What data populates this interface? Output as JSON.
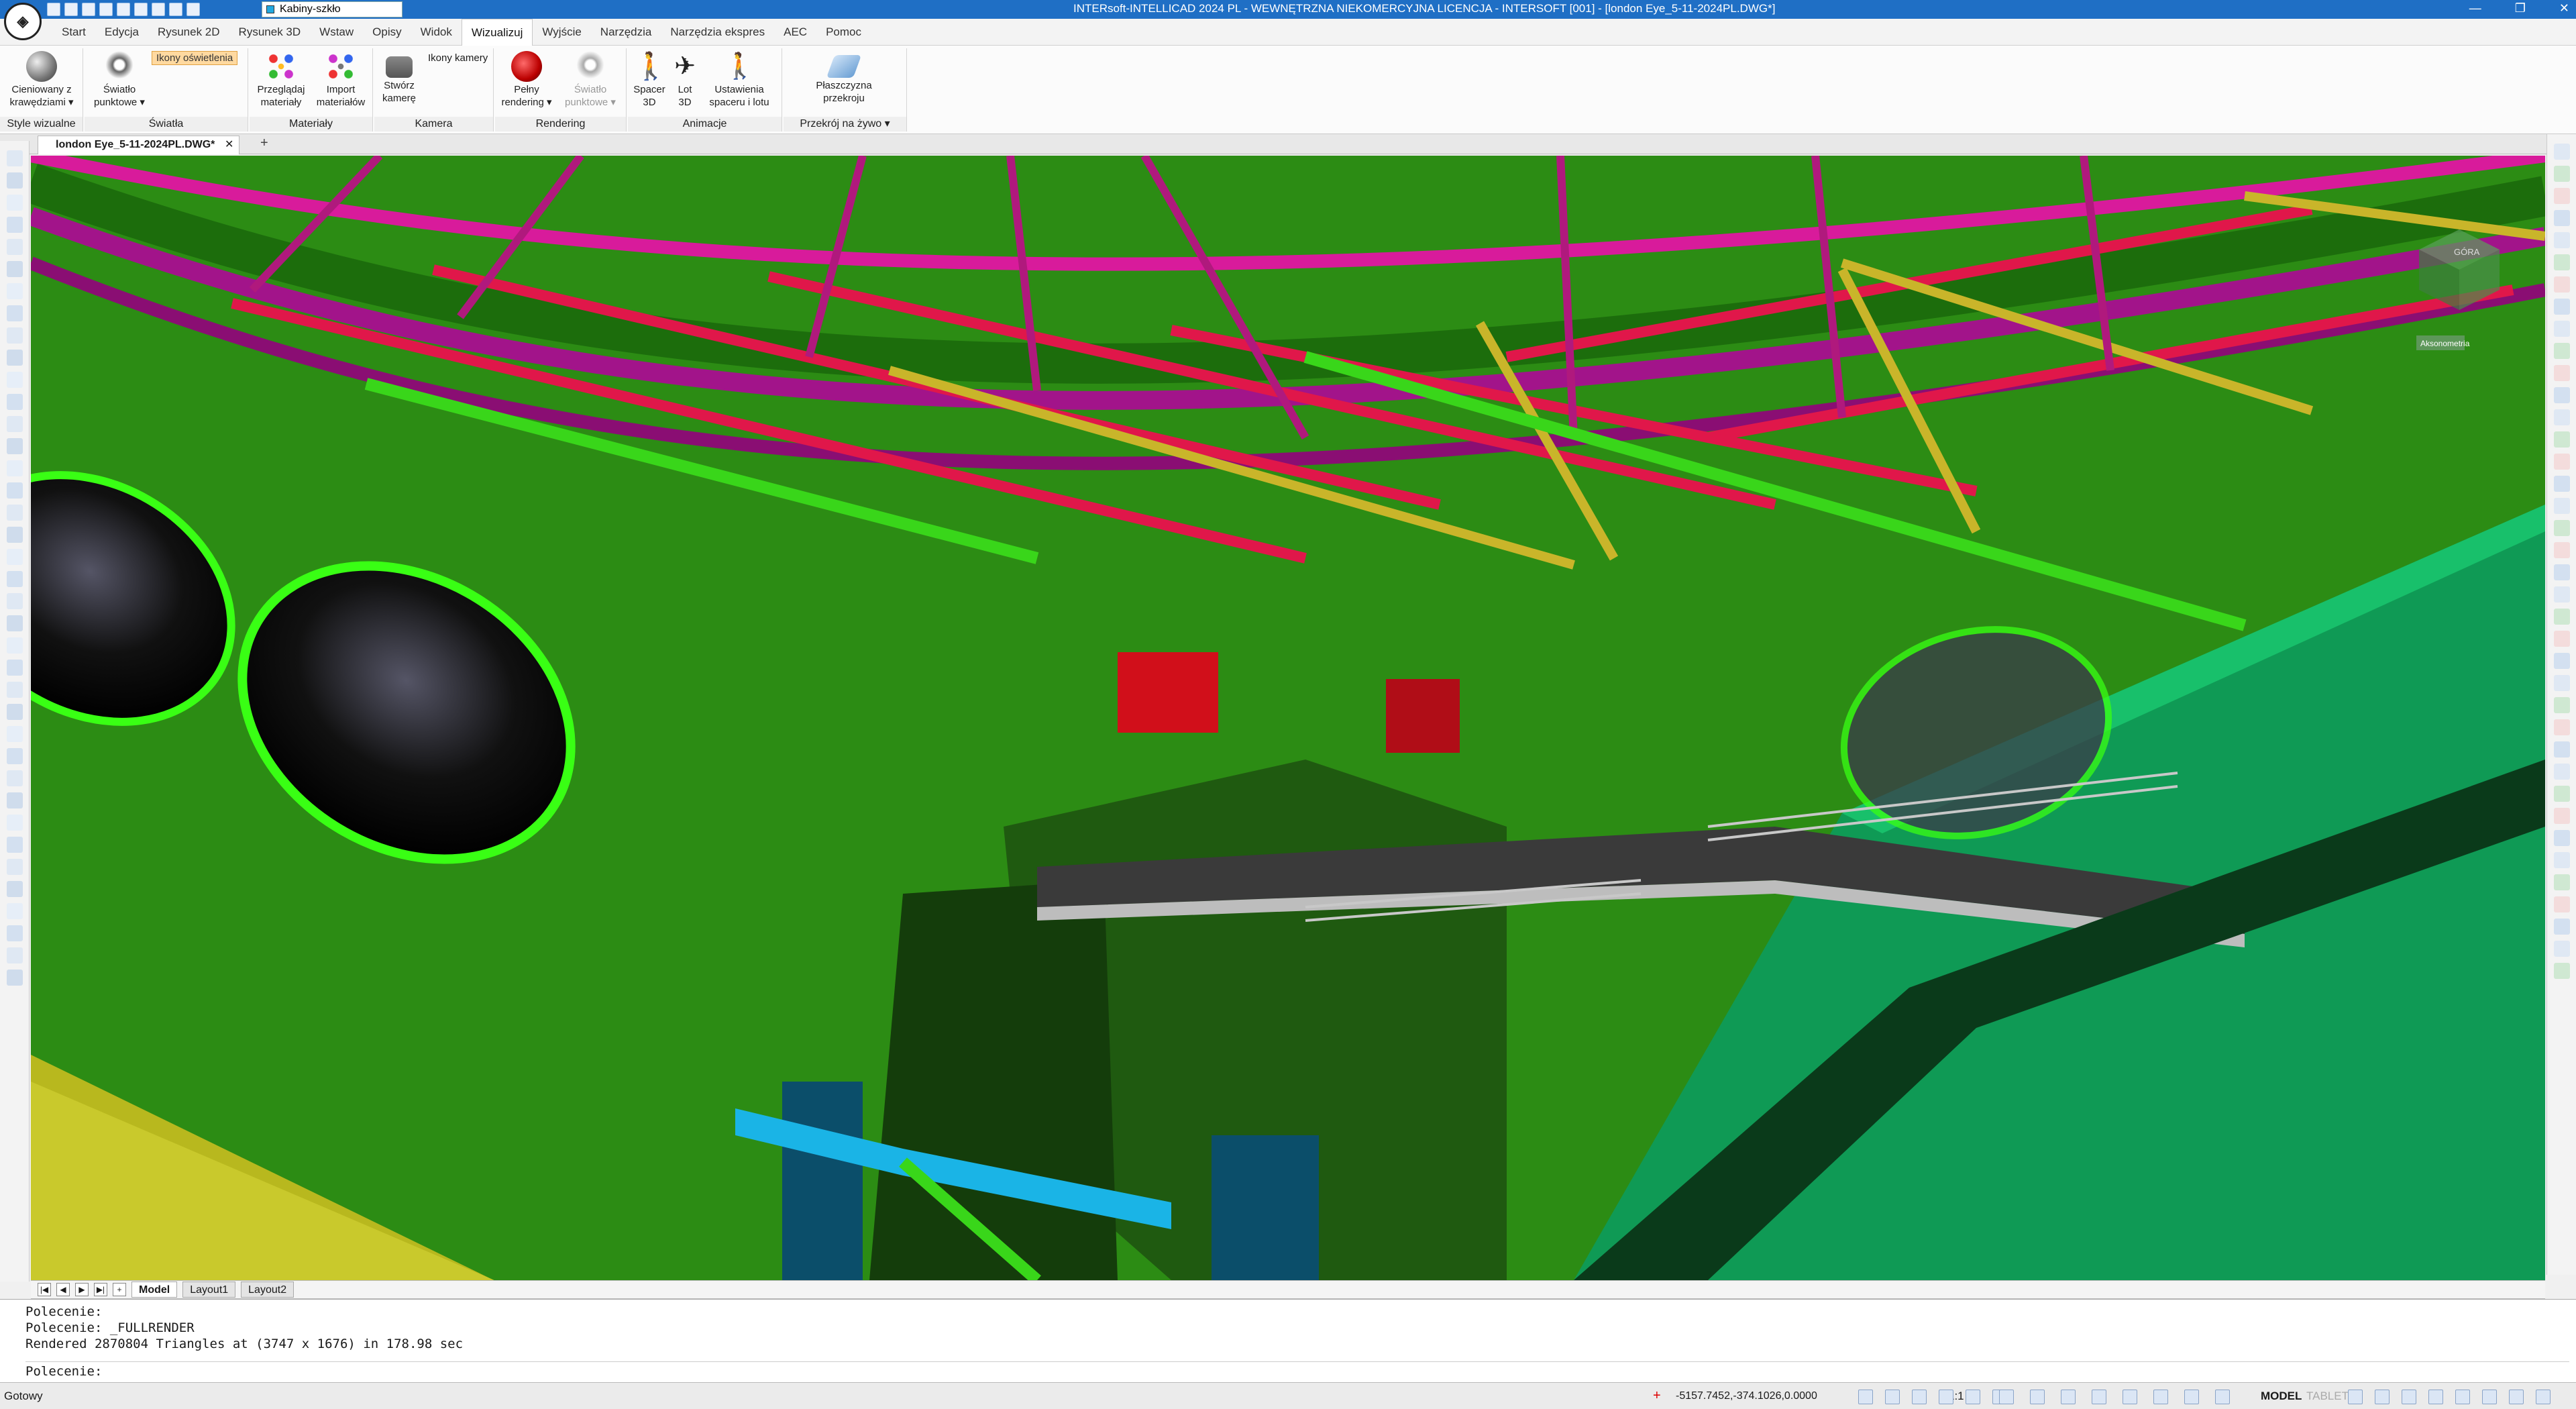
{
  "window": {
    "title": "INTERsoft-INTELLICAD 2024 PL - WEWNĘTRZNA NIEKOMERCYJNA LICENCJA - INTERSOFT [001] - [london Eye_5-11-2024PL.DWG*]",
    "layer": "Kabiny-szkło"
  },
  "menu": {
    "tabs": [
      "Start",
      "Edycja",
      "Rysunek 2D",
      "Rysunek 3D",
      "Wstaw",
      "Opisy",
      "Widok",
      "Wizualizuj",
      "Wyjście",
      "Narzędzia",
      "Narzędzia ekspres",
      "AEC",
      "Pomoc"
    ],
    "active": "Wizualizuj"
  },
  "ribbon": {
    "styles": {
      "title": "Style wizualne",
      "btn1": "Cieniowany z",
      "btn2": "krawędziami"
    },
    "lights": {
      "title": "Światła",
      "btn1": "Światło",
      "btn2": "punktowe",
      "badge": "Ikony oświetlenia"
    },
    "materials": {
      "title": "Materiały",
      "browse1": "Przeglądaj",
      "browse2": "materiały",
      "import1": "Import",
      "import2": "materiałów"
    },
    "camera": {
      "title": "Kamera",
      "create1": "Stwórz",
      "create2": "kamerę",
      "icons": "Ikony kamery"
    },
    "rendering": {
      "title": "Rendering",
      "full1": "Pełny",
      "full2": "rendering",
      "light1": "Światło",
      "light2": "punktowe"
    },
    "animations": {
      "title": "Animacje",
      "walk1": "Spacer",
      "walk2": "3D",
      "fly1": "Lot",
      "fly2": "3D",
      "set1": "Ustawienia",
      "set2": "spaceru i lotu"
    },
    "section": {
      "title": "Przekrój na żywo",
      "plane1": "Płaszczyzna",
      "plane2": "przekroju"
    }
  },
  "document": {
    "tab": "london Eye_5-11-2024PL.DWG*",
    "close": "✕",
    "new": "+"
  },
  "layouts": {
    "tabs": [
      "Model",
      "Layout1",
      "Layout2"
    ],
    "active": "Model"
  },
  "command": {
    "lines": [
      "Polecenie:",
      "Polecenie: _FULLRENDER",
      "Rendered 2870804 Triangles at (3747 x 1676) in 178.98 sec"
    ],
    "prompt": "Polecenie:"
  },
  "status": {
    "ready": "Gotowy",
    "coords": "-5157.7452,-374.1026,0.0000",
    "scale": "1:1",
    "mode": "MODEL",
    "tablet": "TABLET"
  },
  "viewcube": {
    "face": "GÓRA",
    "label": "Aksonometria"
  },
  "colors": {
    "titlebar": "#1f6fc5",
    "scene_bg": "#2b8a12",
    "truss_magenta": "#c2189b",
    "truss_red": "#e0174a",
    "truss_yellow": "#c9b52a"
  }
}
